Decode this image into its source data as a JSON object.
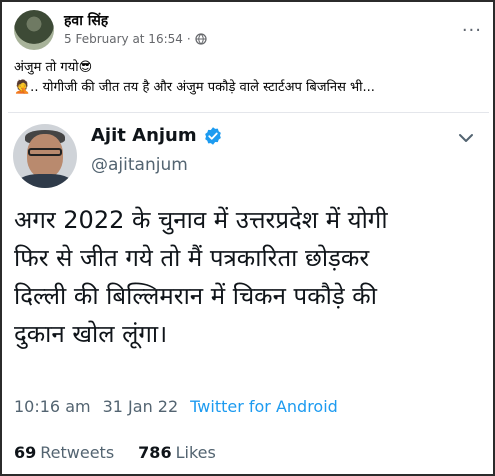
{
  "post": {
    "author": "हवा सिंह",
    "timestamp": "5 February at 16:54",
    "separator": "·",
    "caption_line1": "अंजुम तो गयो😎",
    "caption_line2": "🤦.. योगीजी की जीत तय है और अंजुम पकौड़े वाले स्टार्टअप बिजनिस भी...",
    "more_label": "···"
  },
  "tweet": {
    "name": "Ajit Anjum",
    "handle": "@ajitanjum",
    "text_lines": [
      "अगर 2022 के चुनाव में उत्तरप्रदेश में योगी",
      "फिर से जीत गये तो मैं पत्रकारिता छोड़कर",
      "दिल्ली की बिल्लिमरान में चिकन पकौड़े की",
      "दुकान खोल लूंगा।"
    ],
    "time": "10:16 am",
    "date": "31 Jan 22",
    "source": "Twitter for Android",
    "retweets_count": "69",
    "retweets_label": "Retweets",
    "likes_count": "786",
    "likes_label": "Likes"
  },
  "colors": {
    "link_blue": "#1d9bf0",
    "verified_blue": "#1d9bf0",
    "muted": "#536471"
  },
  "icons": [
    "globe-icon",
    "more-icon",
    "verified-icon",
    "chevron-down-icon"
  ]
}
